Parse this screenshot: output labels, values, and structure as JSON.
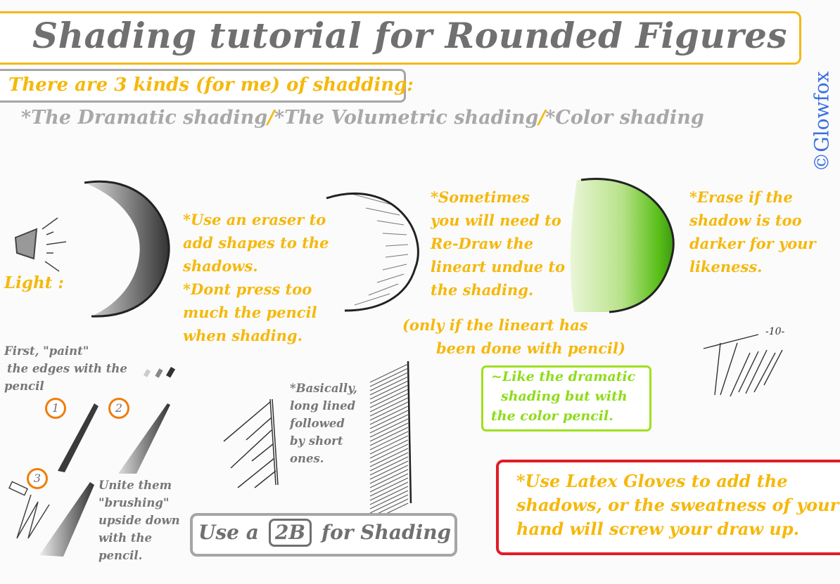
{
  "title": "Shading tutorial for Rounded Figures",
  "watermark": "©Glowfox",
  "intro": {
    "heading": "There are 3 kinds (for me) of shadding:",
    "types": [
      "*The Dramatic shading",
      "*The Volumetric shading",
      "*Color shading"
    ],
    "separator": "/"
  },
  "dramatic": {
    "light_label": "Light :",
    "notes": [
      "*Use an eraser to",
      "add shapes to the",
      "shadows.",
      "*Dont press too",
      "much the pencil",
      "when shading."
    ]
  },
  "volumetric": {
    "notes": [
      "*Sometimes",
      "you will need to",
      "Re-Draw the",
      "lineart undue to",
      "the shading."
    ],
    "caveat": [
      "(only if the lineart has",
      "been done with pencil)"
    ]
  },
  "color": {
    "notes": [
      "*Erase if the",
      "shadow is too",
      "darker for your",
      "likeness."
    ],
    "box": [
      "~Like the dramatic",
      "shading but with",
      "the color pencil."
    ],
    "accent": "#8edc1a"
  },
  "steps": {
    "first": [
      "First, \"paint\"",
      "the edges with the",
      "pencil"
    ],
    "step_numbers": [
      "1",
      "2",
      "3"
    ],
    "unite": [
      "Unite them",
      "\"brushing\"",
      "upside down",
      "with the",
      "pencil."
    ]
  },
  "hatching": {
    "note": [
      "*Basically,",
      "long lined",
      "followed",
      "by short",
      "ones."
    ]
  },
  "pencil": {
    "prefix": "Use a",
    "grade": "2B",
    "suffix": "for Shading"
  },
  "tip": {
    "lines": [
      "*Use Latex Gloves to add the",
      "shadows, or the sweatness of your",
      "hand will screw your draw up."
    ],
    "border_color": "#e21b25"
  },
  "signature": "-10-",
  "colors": {
    "yellow": "#f5b80c",
    "grey": "#777777",
    "title_border": "#f4b913",
    "orange": "#f07d0d",
    "watermark": "#3a6fe0"
  }
}
